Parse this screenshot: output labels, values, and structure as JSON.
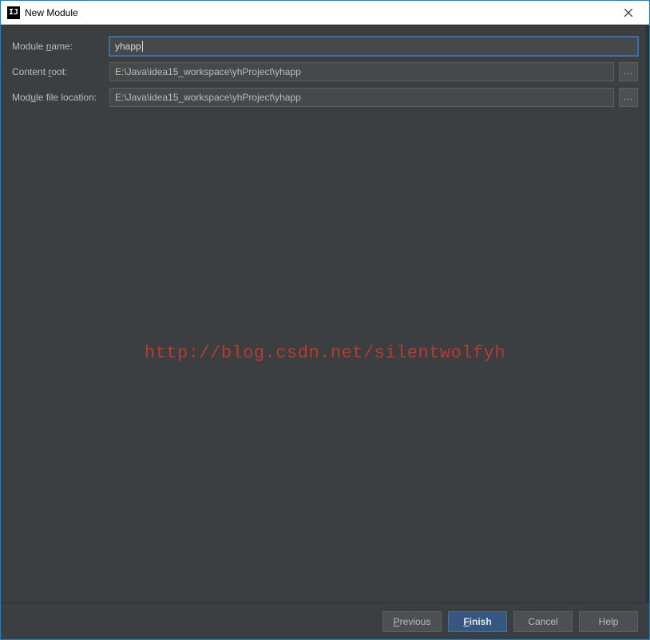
{
  "window": {
    "title": "New Module"
  },
  "fields": {
    "module_name": {
      "label_pre": "Module ",
      "label_ul": "n",
      "label_post": "ame:",
      "value": "yhapp"
    },
    "content_root": {
      "label_pre": "Content ",
      "label_ul": "r",
      "label_post": "oot:",
      "value": "E:\\Java\\idea15_workspace\\yhProject\\yhapp"
    },
    "module_file_location": {
      "label_pre": "Mod",
      "label_ul": "u",
      "label_post": "le file location:",
      "value": "E:\\Java\\idea15_workspace\\yhProject\\yhapp"
    }
  },
  "browse_label": "...",
  "watermark": "http://blog.csdn.net/silentwolfyh",
  "buttons": {
    "previous": {
      "ul": "P",
      "rest": "revious"
    },
    "finish": {
      "ul": "F",
      "rest": "inish"
    },
    "cancel": {
      "text": "Cancel"
    },
    "help": {
      "text": "Help"
    }
  }
}
